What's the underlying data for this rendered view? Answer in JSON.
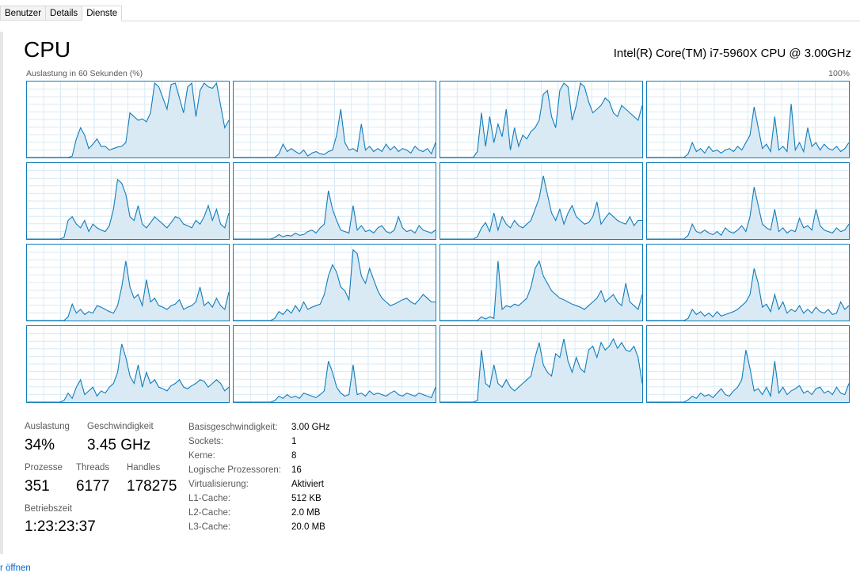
{
  "tabs": [
    "Benutzer",
    "Details",
    "Dienste"
  ],
  "header": {
    "title": "CPU",
    "cpu_model": "Intel(R) Core(TM) i7-5960X CPU @ 3.00GHz",
    "graph_label": "Auslastung in 60 Sekunden (%)",
    "graph_max": "100%"
  },
  "stats": {
    "utilization_label": "Auslastung",
    "utilization": "34%",
    "speed_label": "Geschwindigkeit",
    "speed": "3.45 GHz",
    "processes_label": "Prozesse",
    "processes": "351",
    "threads_label": "Threads",
    "threads": "6177",
    "handles_label": "Handles",
    "handles": "178275",
    "uptime_label": "Betriebszeit",
    "uptime": "1:23:23:37"
  },
  "details": [
    {
      "key": "Basisgeschwindigkeit:",
      "value": "3.00 GHz"
    },
    {
      "key": "Sockets:",
      "value": "1"
    },
    {
      "key": "Kerne:",
      "value": "8"
    },
    {
      "key": "Logische Prozessoren:",
      "value": "16"
    },
    {
      "key": "Virtualisierung:",
      "value": "Aktiviert"
    },
    {
      "key": "L1-Cache:",
      "value": "512 KB"
    },
    {
      "key": "L2-Cache:",
      "value": "2.0 MB"
    },
    {
      "key": "L3-Cache:",
      "value": "20.0 MB"
    }
  ],
  "footer": {
    "link": "r öffnen"
  },
  "colors": {
    "line": "#117dbb",
    "fill": "#d9eaf5",
    "grid": "#d9eaf4"
  },
  "chart_data": {
    "type": "area",
    "ylim": [
      0,
      100
    ],
    "cores": [
      [
        0,
        0,
        0,
        0,
        0,
        0,
        0,
        0,
        0,
        0,
        0,
        2,
        25,
        40,
        30,
        12,
        18,
        25,
        15,
        15,
        10,
        12,
        14,
        15,
        20,
        60,
        55,
        50,
        52,
        48,
        60,
        100,
        95,
        80,
        65,
        98,
        100,
        80,
        60,
        95,
        100,
        55,
        90,
        100,
        95,
        93,
        100,
        70,
        40,
        50
      ],
      [
        0,
        0,
        0,
        0,
        0,
        0,
        0,
        0,
        0,
        0,
        0,
        5,
        18,
        8,
        12,
        8,
        5,
        10,
        2,
        6,
        8,
        5,
        4,
        8,
        10,
        30,
        65,
        20,
        10,
        12,
        8,
        45,
        10,
        15,
        8,
        12,
        8,
        18,
        10,
        15,
        8,
        12,
        10,
        6,
        15,
        10,
        8,
        12,
        5,
        20
      ],
      [
        0,
        0,
        0,
        0,
        0,
        0,
        0,
        0,
        0,
        8,
        60,
        15,
        55,
        20,
        45,
        28,
        65,
        10,
        40,
        15,
        30,
        25,
        35,
        40,
        50,
        85,
        90,
        55,
        40,
        90,
        100,
        95,
        50,
        70,
        100,
        95,
        75,
        60,
        65,
        70,
        80,
        75,
        60,
        55,
        70,
        65,
        60,
        55,
        50,
        70
      ],
      [
        0,
        0,
        0,
        0,
        0,
        0,
        0,
        0,
        0,
        0,
        5,
        20,
        8,
        12,
        6,
        15,
        8,
        10,
        6,
        10,
        12,
        8,
        15,
        10,
        20,
        30,
        68,
        40,
        12,
        18,
        8,
        55,
        10,
        15,
        8,
        72,
        10,
        20,
        8,
        40,
        15,
        20,
        10,
        18,
        12,
        10,
        15,
        8,
        12,
        20
      ],
      [
        0,
        0,
        0,
        0,
        0,
        0,
        0,
        0,
        0,
        2,
        25,
        30,
        20,
        15,
        25,
        10,
        20,
        15,
        12,
        10,
        18,
        40,
        80,
        75,
        60,
        30,
        25,
        45,
        20,
        15,
        22,
        30,
        25,
        20,
        15,
        22,
        30,
        28,
        20,
        18,
        15,
        25,
        20,
        30,
        45,
        25,
        40,
        20,
        15,
        35
      ],
      [
        0,
        0,
        0,
        0,
        0,
        0,
        0,
        0,
        0,
        0,
        2,
        6,
        3,
        5,
        4,
        8,
        5,
        6,
        10,
        12,
        8,
        15,
        20,
        65,
        40,
        25,
        12,
        10,
        8,
        45,
        12,
        18,
        10,
        12,
        8,
        15,
        18,
        10,
        8,
        12,
        30,
        15,
        10,
        12,
        8,
        18,
        12,
        10,
        8,
        12
      ],
      [
        0,
        0,
        0,
        0,
        0,
        0,
        0,
        0,
        0,
        3,
        15,
        22,
        10,
        35,
        12,
        30,
        20,
        15,
        25,
        18,
        15,
        20,
        25,
        40,
        55,
        85,
        60,
        35,
        25,
        40,
        20,
        35,
        45,
        30,
        25,
        20,
        22,
        30,
        50,
        20,
        28,
        35,
        30,
        25,
        22,
        20,
        30,
        18,
        25,
        25
      ],
      [
        0,
        0,
        0,
        0,
        0,
        0,
        0,
        0,
        0,
        0,
        5,
        20,
        10,
        8,
        12,
        8,
        6,
        10,
        5,
        15,
        10,
        8,
        12,
        18,
        10,
        30,
        70,
        45,
        20,
        15,
        12,
        40,
        10,
        15,
        8,
        12,
        10,
        28,
        15,
        18,
        12,
        40,
        18,
        12,
        10,
        8,
        15,
        10,
        12,
        20
      ],
      [
        0,
        0,
        0,
        0,
        0,
        0,
        0,
        0,
        0,
        0,
        5,
        22,
        10,
        15,
        8,
        12,
        10,
        20,
        18,
        15,
        12,
        10,
        20,
        45,
        80,
        45,
        30,
        35,
        20,
        55,
        25,
        30,
        20,
        18,
        15,
        20,
        22,
        28,
        15,
        18,
        20,
        25,
        45,
        20,
        25,
        18,
        30,
        20,
        15,
        38
      ],
      [
        0,
        0,
        0,
        0,
        0,
        0,
        0,
        0,
        0,
        0,
        3,
        12,
        8,
        15,
        10,
        20,
        12,
        25,
        15,
        18,
        20,
        22,
        35,
        60,
        75,
        65,
        45,
        40,
        28,
        95,
        90,
        60,
        50,
        70,
        55,
        40,
        30,
        25,
        20,
        22,
        25,
        28,
        30,
        25,
        22,
        28,
        35,
        30,
        25,
        25
      ],
      [
        0,
        0,
        0,
        0,
        0,
        0,
        0,
        0,
        0,
        0,
        5,
        2,
        5,
        3,
        80,
        15,
        20,
        18,
        22,
        20,
        25,
        30,
        45,
        70,
        80,
        60,
        50,
        40,
        35,
        30,
        28,
        25,
        22,
        20,
        18,
        15,
        20,
        25,
        30,
        40,
        25,
        30,
        35,
        25,
        20,
        50,
        25,
        20,
        15,
        35
      ],
      [
        0,
        0,
        0,
        0,
        0,
        0,
        0,
        0,
        0,
        0,
        3,
        15,
        8,
        12,
        6,
        10,
        5,
        12,
        6,
        8,
        10,
        12,
        15,
        20,
        25,
        35,
        70,
        50,
        18,
        22,
        12,
        35,
        15,
        25,
        10,
        15,
        12,
        20,
        10,
        15,
        10,
        18,
        12,
        10,
        15,
        8,
        10,
        25,
        15,
        20
      ],
      [
        0,
        0,
        0,
        0,
        0,
        0,
        0,
        0,
        0,
        2,
        12,
        5,
        20,
        30,
        10,
        15,
        20,
        8,
        15,
        12,
        20,
        25,
        40,
        78,
        60,
        35,
        25,
        50,
        20,
        40,
        25,
        30,
        20,
        18,
        15,
        22,
        25,
        30,
        20,
        18,
        22,
        25,
        30,
        28,
        20,
        25,
        30,
        25,
        15,
        20
      ],
      [
        0,
        0,
        0,
        0,
        0,
        0,
        0,
        0,
        0,
        0,
        2,
        8,
        5,
        10,
        6,
        8,
        5,
        12,
        10,
        8,
        6,
        10,
        15,
        55,
        40,
        20,
        12,
        8,
        10,
        50,
        10,
        12,
        8,
        15,
        10,
        12,
        10,
        8,
        12,
        15,
        10,
        8,
        12,
        10,
        8,
        12,
        10,
        8,
        6,
        20
      ],
      [
        0,
        0,
        0,
        0,
        0,
        0,
        0,
        0,
        0,
        2,
        70,
        25,
        20,
        50,
        25,
        20,
        30,
        20,
        15,
        20,
        25,
        30,
        35,
        60,
        80,
        50,
        40,
        35,
        65,
        60,
        85,
        55,
        40,
        60,
        45,
        40,
        70,
        75,
        60,
        80,
        70,
        75,
        85,
        72,
        80,
        70,
        68,
        75,
        60,
        25
      ],
      [
        0,
        0,
        0,
        0,
        0,
        0,
        0,
        0,
        0,
        0,
        3,
        8,
        5,
        12,
        8,
        10,
        6,
        12,
        18,
        10,
        8,
        15,
        20,
        30,
        70,
        45,
        15,
        18,
        10,
        20,
        8,
        55,
        12,
        20,
        10,
        15,
        18,
        22,
        12,
        15,
        10,
        18,
        20,
        12,
        15,
        10,
        20,
        12,
        10,
        25
      ]
    ]
  }
}
